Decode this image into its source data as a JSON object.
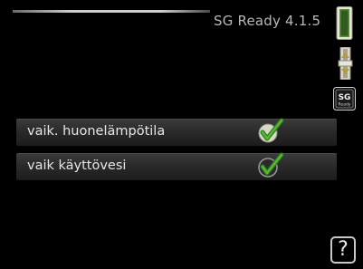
{
  "header": {
    "title": "SG Ready 4.1.5"
  },
  "options": [
    {
      "label": "vaik. huonelämpötila",
      "checked": true
    },
    {
      "label": "vaik käyttövesi",
      "checked": true
    }
  ],
  "indicators": {
    "slider_icon": "slider-icon",
    "adjust_icon": "adjust-arrows-icon",
    "badge": {
      "icon": "sg-ready-badge-icon",
      "big": "SG",
      "small": "Ready"
    }
  },
  "help": {
    "label": "?"
  },
  "colors": {
    "background": "#000000",
    "text": "#e6e6e6",
    "check_green": "#49a82e"
  }
}
